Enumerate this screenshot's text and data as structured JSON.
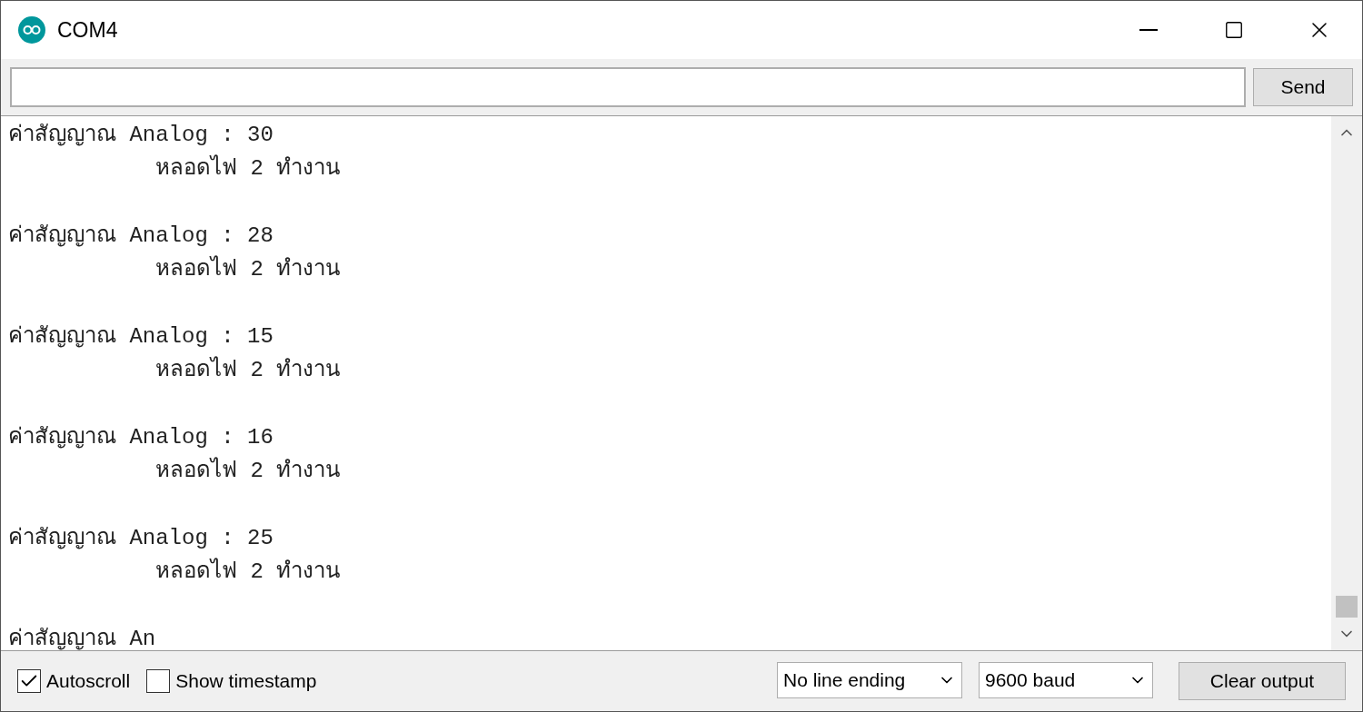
{
  "window": {
    "title": "COM4"
  },
  "input": {
    "send_button": "Send"
  },
  "output": [
    {
      "reading": "ค่าสัญญาณ Analog : 30",
      "status": "หลอดไฟ 2 ทำงาน"
    },
    {
      "reading": "ค่าสัญญาณ Analog : 28",
      "status": "หลอดไฟ 2 ทำงาน"
    },
    {
      "reading": "ค่าสัญญาณ Analog : 15",
      "status": "หลอดไฟ 2 ทำงาน"
    },
    {
      "reading": "ค่าสัญญาณ Analog : 16",
      "status": "หลอดไฟ 2 ทำงาน"
    },
    {
      "reading": "ค่าสัญญาณ Analog : 25",
      "status": "หลอดไฟ 2 ทำงาน"
    },
    {
      "reading": "ค่าสัญญาณ An"
    }
  ],
  "footer": {
    "checkboxes": [
      {
        "label": "Autoscroll",
        "checked": true
      },
      {
        "label": "Show timestamp",
        "checked": false
      }
    ],
    "line_ending": "No line ending",
    "baud": "9600 baud",
    "clear_button": "Clear output"
  }
}
